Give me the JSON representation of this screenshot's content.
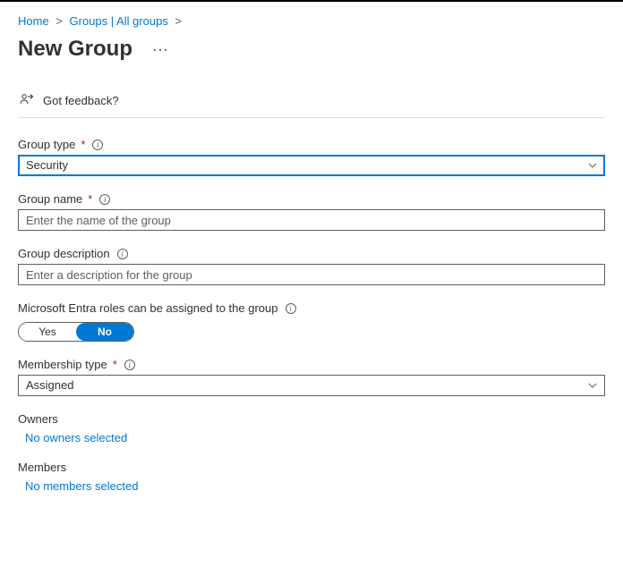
{
  "breadcrumb": {
    "home": "Home",
    "groups": "Groups | All groups"
  },
  "title": "New Group",
  "feedback": "Got feedback?",
  "fields": {
    "groupType": {
      "label": "Group type",
      "value": "Security"
    },
    "groupName": {
      "label": "Group name",
      "placeholder": "Enter the name of the group"
    },
    "groupDesc": {
      "label": "Group description",
      "placeholder": "Enter a description for the group"
    },
    "entraRoles": {
      "label": "Microsoft Entra roles can be assigned to the group",
      "yes": "Yes",
      "no": "No"
    },
    "membershipType": {
      "label": "Membership type",
      "value": "Assigned"
    }
  },
  "sections": {
    "owners": {
      "label": "Owners",
      "empty": "No owners selected"
    },
    "members": {
      "label": "Members",
      "empty": "No members selected"
    }
  }
}
